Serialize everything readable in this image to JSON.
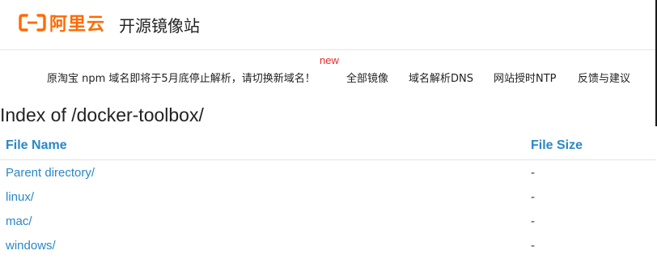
{
  "header": {
    "logo_text": "阿里云",
    "logo_icon": "aliyun-bracket-icon",
    "site_title": "开源镜像站"
  },
  "colors": {
    "brand": "#ff6a00",
    "link": "#2a87c7",
    "new_badge": "#e62b2b"
  },
  "nav": {
    "notice": "原淘宝 npm 域名即将于5月底停止解析，请切换新域名！",
    "new_badge": "new",
    "links": [
      "全部镜像",
      "域名解析DNS",
      "网站授时NTP",
      "反馈与建议"
    ]
  },
  "page": {
    "heading": "Index of /docker-toolbox/"
  },
  "listing": {
    "columns": [
      "File Name",
      "File Size"
    ],
    "rows": [
      {
        "name": "Parent directory/",
        "size": "-"
      },
      {
        "name": "linux/",
        "size": "-"
      },
      {
        "name": "mac/",
        "size": "-"
      },
      {
        "name": "windows/",
        "size": "-"
      }
    ]
  }
}
